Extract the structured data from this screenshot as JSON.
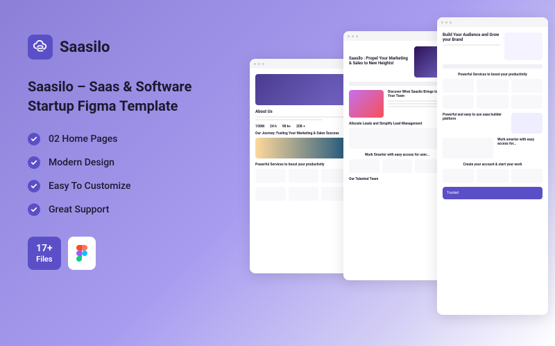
{
  "brand": {
    "name": "Saasilo"
  },
  "title": "Saasilo – Saas & Software Startup Figma Template",
  "features": [
    "02 Home Pages",
    "Modern Design",
    "Easy To Customize",
    "Great Support"
  ],
  "badge": {
    "count": "17+",
    "label": "Files"
  },
  "mockups": {
    "m1": {
      "about": "About Us",
      "stats": [
        "100M",
        "24 h",
        "98 k+",
        "208 +"
      ],
      "journey": "Our Journey: Fueling Your Marketing & Sales Success",
      "services": "Powerful Services to boost your productivity"
    },
    "m2": {
      "hero": "Saasilo : Propel Your Marketing & Sales to New Heights!",
      "discover": "Discover What Saasilo Brings to Your Team",
      "leads": "Allocate Leads and Simplify Lead Management",
      "smarter": "Work Smarter with easy access for user...",
      "team": "Our Talanted Team"
    },
    "m3": {
      "hero": "Build Your Audience and Grow your Brand",
      "services": "Powerful Services to boost your productivity",
      "platform": "Powerful and easy to use saas builder platform",
      "work": "Work smarter with easy access for...",
      "create": "Create your account & start your work",
      "trusted": "Trusted"
    }
  }
}
